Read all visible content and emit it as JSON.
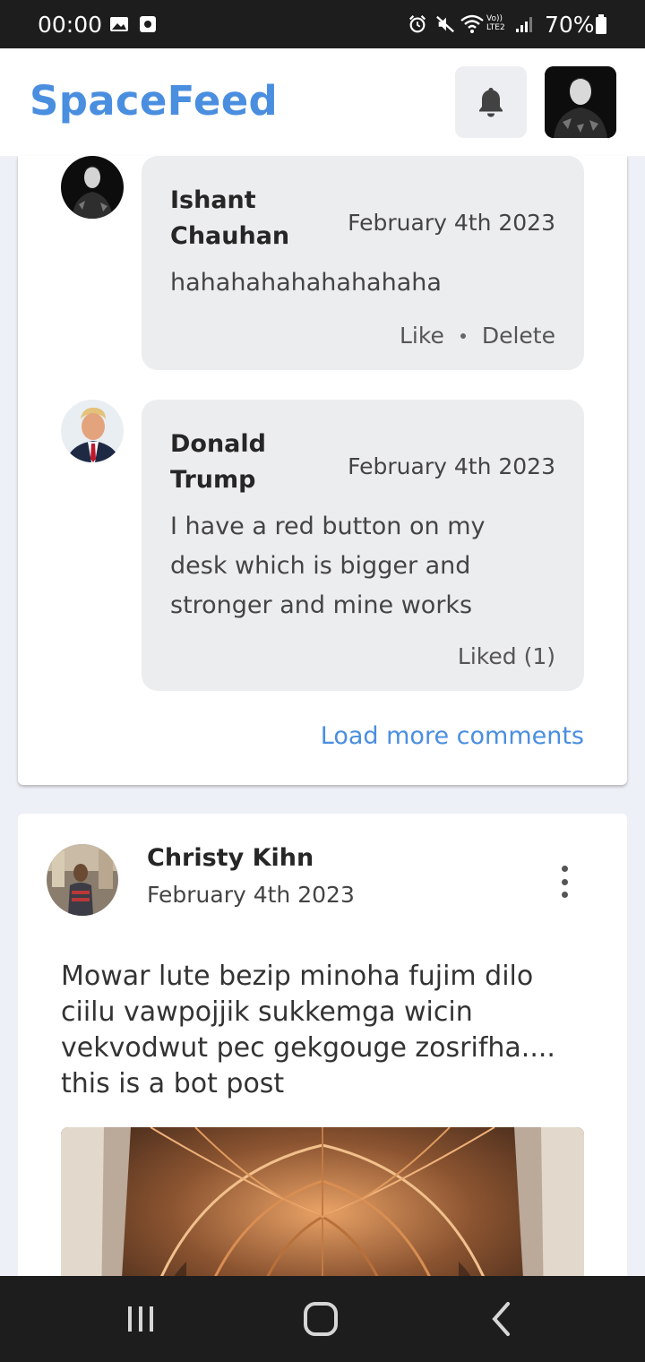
{
  "status_bar": {
    "time": "00:00",
    "battery_percent": "70%",
    "network_label": "Vo)) LTE2",
    "icons": [
      "gallery-icon",
      "screenshot-icon",
      "alarm-icon",
      "mute-icon",
      "wifi-icon",
      "signal-icon",
      "battery-icon"
    ]
  },
  "header": {
    "brand": "SpaceFeed",
    "brand_color": "#4a8ee0",
    "notification_icon": "bell-icon"
  },
  "comments": [
    {
      "author": "Ishant Chauhan",
      "date": "February 4th 2023",
      "text": "hahahahahahahahaha",
      "like_label": "Like",
      "delete_label": "Delete"
    },
    {
      "author": "Donald Trump",
      "date": "February 4th 2023",
      "text": "I have a red button on my desk which is bigger and stronger and mine works",
      "liked_label": "Liked (1)"
    }
  ],
  "load_more_label": "Load more comments",
  "post": {
    "author": "Christy Kihn",
    "date": "February 4th 2023",
    "text": "Mowar lute bezip minoha fujim dilo ciilu vawpojjik sukkemga wicin vekvodwut pec gekgouge zosrifha.... this is a bot post",
    "menu_icon": "more-vertical-icon"
  },
  "nav_bar": {
    "icons": [
      "recent-apps-icon",
      "home-icon",
      "back-icon"
    ]
  }
}
